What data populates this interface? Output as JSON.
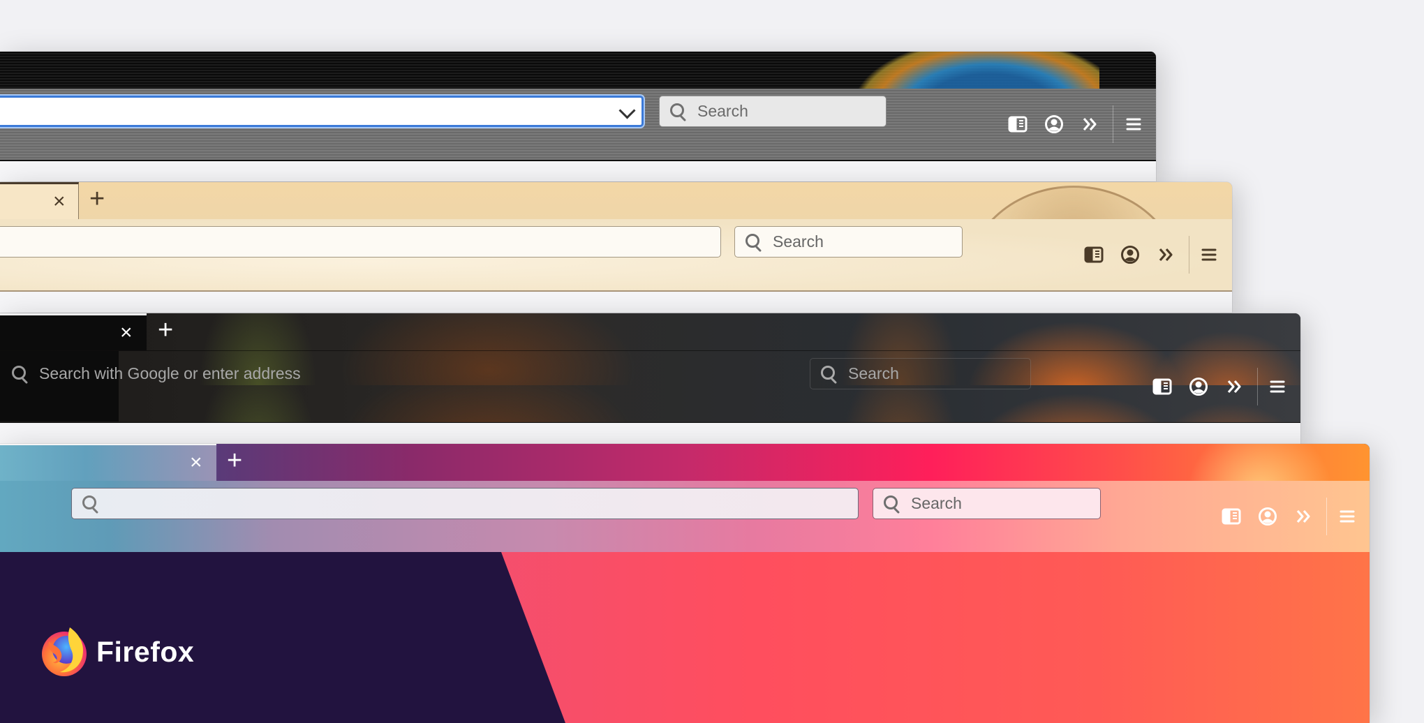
{
  "windows": [
    {
      "theme": "dark-firefox-globe",
      "url_bar": {
        "value": "",
        "focused": true,
        "dropdown_icon": "chevron-down-icon"
      },
      "search_bar": {
        "placeholder": "Search"
      },
      "toolbar_icons": [
        "sidebar-icon",
        "account-icon",
        "overflow-icon",
        "menu-icon"
      ]
    },
    {
      "theme": "parchment",
      "tab": {
        "close_label": "×"
      },
      "new_tab_label": "+",
      "url_bar": {
        "value": ""
      },
      "search_bar": {
        "placeholder": "Search"
      },
      "toolbar_icons": [
        "sidebar-icon",
        "account-icon",
        "overflow-icon",
        "menu-icon"
      ]
    },
    {
      "theme": "forest-fox",
      "tab": {
        "close_label": "×"
      },
      "new_tab_label": "+",
      "url_bar": {
        "placeholder": "Search with Google or enter address"
      },
      "search_bar": {
        "placeholder": "Search"
      },
      "toolbar_icons": [
        "sidebar-icon",
        "account-icon",
        "overflow-icon",
        "menu-icon"
      ]
    },
    {
      "theme": "pink-gradient",
      "tab": {
        "close_label": "×"
      },
      "new_tab_label": "+",
      "url_bar": {
        "value": ""
      },
      "search_bar": {
        "placeholder": "Search"
      },
      "toolbar_icons": [
        "sidebar-icon",
        "account-icon",
        "overflow-icon",
        "menu-icon"
      ]
    }
  ],
  "brand": {
    "name": "Firefox"
  },
  "colors": {
    "background": "#f1f1f4",
    "focus_ring": "#3b7ad8",
    "brand_dark": "#22133f",
    "brand_coral": "#ff4e5e"
  }
}
